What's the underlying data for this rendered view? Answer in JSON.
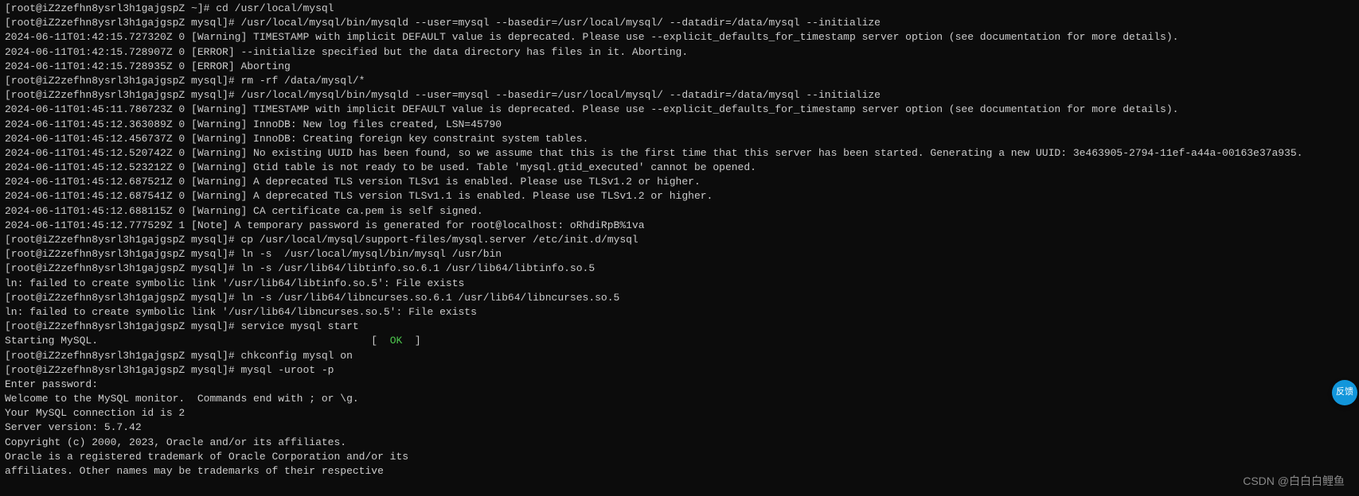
{
  "lines": [
    {
      "text": "[root@iZ2zefhn8ysrl3h1gajgspZ ~]# cd /usr/local/mysql"
    },
    {
      "text": "[root@iZ2zefhn8ysrl3h1gajgspZ mysql]# /usr/local/mysql/bin/mysqld --user=mysql --basedir=/usr/local/mysql/ --datadir=/data/mysql --initialize"
    },
    {
      "text": "2024-06-11T01:42:15.727320Z 0 [Warning] TIMESTAMP with implicit DEFAULT value is deprecated. Please use --explicit_defaults_for_timestamp server option (see documentation for more details)."
    },
    {
      "text": "2024-06-11T01:42:15.728907Z 0 [ERROR] --initialize specified but the data directory has files in it. Aborting."
    },
    {
      "text": "2024-06-11T01:42:15.728935Z 0 [ERROR] Aborting"
    },
    {
      "text": ""
    },
    {
      "text": "[root@iZ2zefhn8ysrl3h1gajgspZ mysql]# rm -rf /data/mysql/*"
    },
    {
      "text": "[root@iZ2zefhn8ysrl3h1gajgspZ mysql]# /usr/local/mysql/bin/mysqld --user=mysql --basedir=/usr/local/mysql/ --datadir=/data/mysql --initialize"
    },
    {
      "text": "2024-06-11T01:45:11.786723Z 0 [Warning] TIMESTAMP with implicit DEFAULT value is deprecated. Please use --explicit_defaults_for_timestamp server option (see documentation for more details)."
    },
    {
      "text": "2024-06-11T01:45:12.363089Z 0 [Warning] InnoDB: New log files created, LSN=45790"
    },
    {
      "text": "2024-06-11T01:45:12.456737Z 0 [Warning] InnoDB: Creating foreign key constraint system tables."
    },
    {
      "text": "2024-06-11T01:45:12.520742Z 0 [Warning] No existing UUID has been found, so we assume that this is the first time that this server has been started. Generating a new UUID: 3e463905-2794-11ef-a44a-00163e37a935."
    },
    {
      "text": "2024-06-11T01:45:12.523212Z 0 [Warning] Gtid table is not ready to be used. Table 'mysql.gtid_executed' cannot be opened."
    },
    {
      "text": "2024-06-11T01:45:12.687521Z 0 [Warning] A deprecated TLS version TLSv1 is enabled. Please use TLSv1.2 or higher."
    },
    {
      "text": "2024-06-11T01:45:12.687541Z 0 [Warning] A deprecated TLS version TLSv1.1 is enabled. Please use TLSv1.2 or higher."
    },
    {
      "text": "2024-06-11T01:45:12.688115Z 0 [Warning] CA certificate ca.pem is self signed."
    },
    {
      "text": "2024-06-11T01:45:12.777529Z 1 [Note] A temporary password is generated for root@localhost: oRhdiRpB%1va"
    },
    {
      "text": "[root@iZ2zefhn8ysrl3h1gajgspZ mysql]# cp /usr/local/mysql/support-files/mysql.server /etc/init.d/mysql"
    },
    {
      "text": "[root@iZ2zefhn8ysrl3h1gajgspZ mysql]# ln -s  /usr/local/mysql/bin/mysql /usr/bin"
    },
    {
      "text": "[root@iZ2zefhn8ysrl3h1gajgspZ mysql]# ln -s /usr/lib64/libtinfo.so.6.1 /usr/lib64/libtinfo.so.5"
    },
    {
      "text": "ln: failed to create symbolic link '/usr/lib64/libtinfo.so.5': File exists"
    },
    {
      "text": "[root@iZ2zefhn8ysrl3h1gajgspZ mysql]# ln -s /usr/lib64/libncurses.so.6.1 /usr/lib64/libncurses.so.5"
    },
    {
      "text": "ln: failed to create symbolic link '/usr/lib64/libncurses.so.5': File exists"
    },
    {
      "text": "[root@iZ2zefhn8ysrl3h1gajgspZ mysql]# service mysql start"
    },
    {
      "type": "ok_line",
      "prefix": "Starting MySQL.                                            [  ",
      "ok": "OK",
      "suffix": "  ]"
    },
    {
      "text": "[root@iZ2zefhn8ysrl3h1gajgspZ mysql]# chkconfig mysql on"
    },
    {
      "text": "[root@iZ2zefhn8ysrl3h1gajgspZ mysql]# mysql -uroot -p"
    },
    {
      "text": "Enter password:"
    },
    {
      "text": "Welcome to the MySQL monitor.  Commands end with ; or \\g."
    },
    {
      "text": "Your MySQL connection id is 2"
    },
    {
      "text": "Server version: 5.7.42"
    },
    {
      "text": ""
    },
    {
      "text": "Copyright (c) 2000, 2023, Oracle and/or its affiliates."
    },
    {
      "text": ""
    },
    {
      "text": "Oracle is a registered trademark of Oracle Corporation and/or its"
    },
    {
      "text": "affiliates. Other names may be trademarks of their respective"
    }
  ],
  "watermark": "CSDN @白白白鲤鱼",
  "badge": "反馈"
}
